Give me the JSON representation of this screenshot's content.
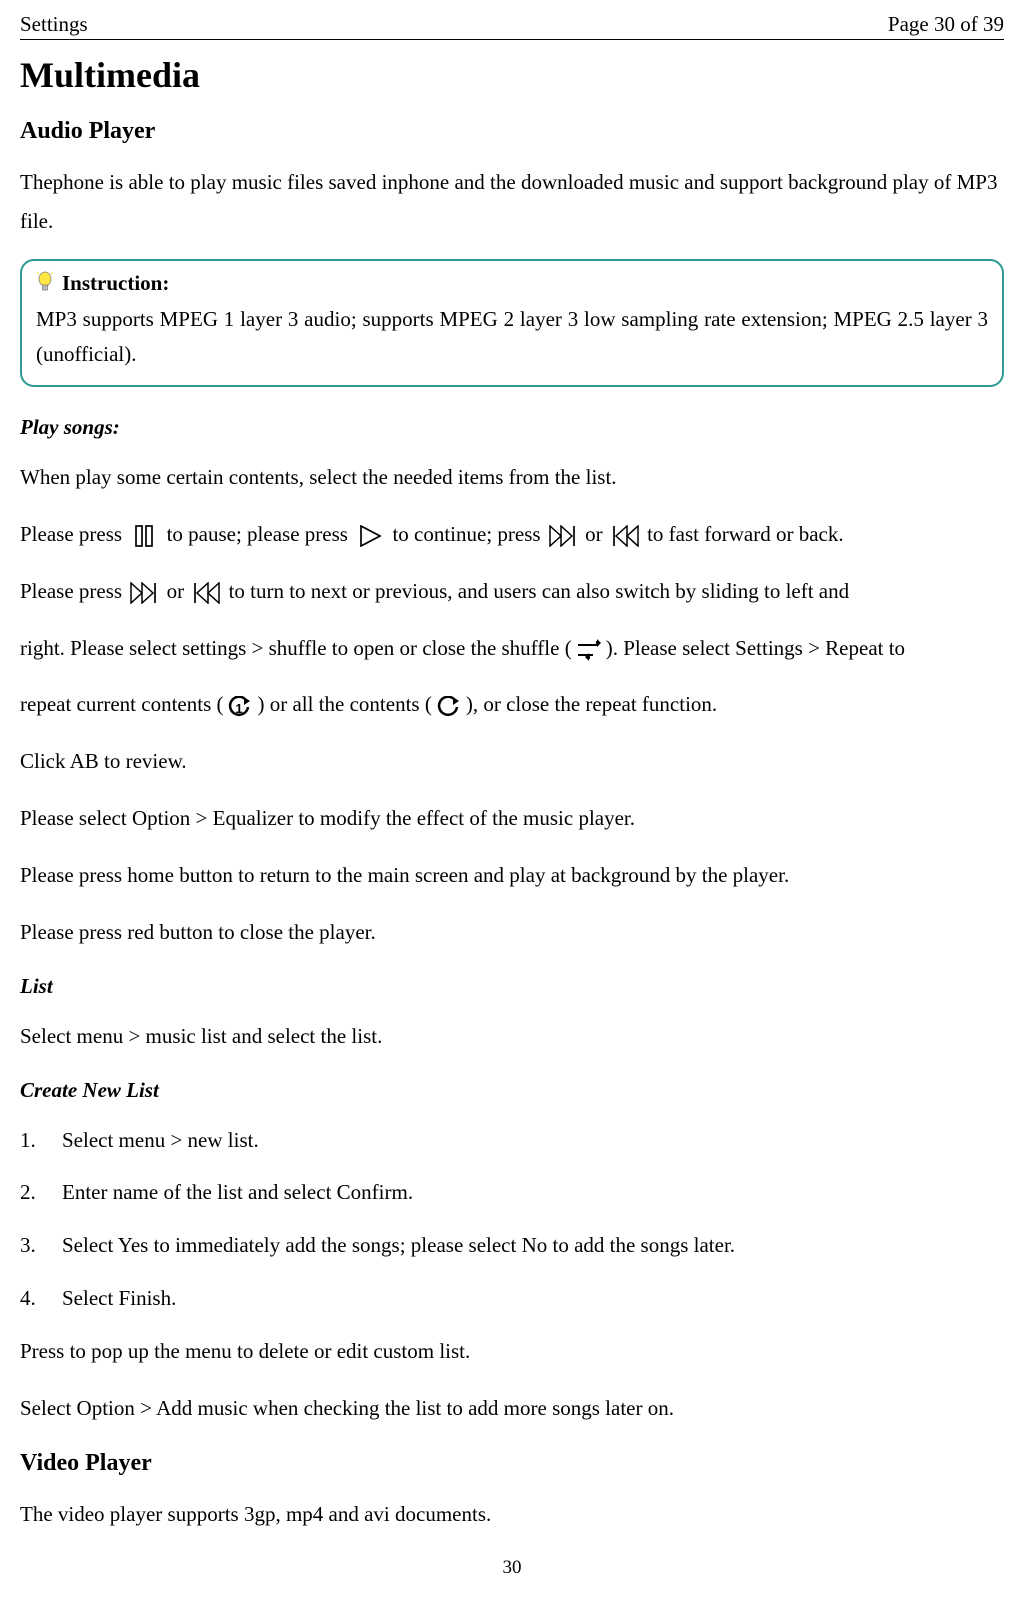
{
  "header": {
    "left": "Settings",
    "right": "Page 30 of 39"
  },
  "title": "Multimedia",
  "audio": {
    "heading": "Audio Player",
    "intro": "Thephone is able to play music files saved inphone and the downloaded music and support background play of MP3 file."
  },
  "callout": {
    "label": " Instruction:",
    "body": "MP3 supports MPEG 1 layer 3 audio; supports MPEG 2 layer 3 low sampling rate extension; MPEG 2.5 layer 3 (unofficial)."
  },
  "play": {
    "heading": "Play songs:",
    "line1": "When play some certain contents, select the needed items from the list.",
    "press1": "Please press",
    "pauseTail": " to pause; please press",
    "continueTail": " to continue; press",
    "orWord": " or",
    "ffbackTail": " to fast forward or back.",
    "press2": "Please press",
    "nextprevTail": " to turn to next or previous, and users can also switch by sliding to left and",
    "line3a": "right. Please select settings > shuffle to open or close the shuffle (",
    "line3b": "). Please select Settings > Repeat to",
    "line4a": "repeat current contents (",
    "line4b": ") or all the contents (",
    "line4c": "), or close the repeat function.",
    "abReview": "Click AB to review.",
    "equalizer": "Please select Option > Equalizer to modify the effect of the music player.",
    "homeBtn": "Please press home button to return to the main screen and play at background by the player.",
    "redBtn": "Please press red button to close the player."
  },
  "list": {
    "heading": "List",
    "text": "Select menu > music list and select the list."
  },
  "createList": {
    "heading": "Create New List",
    "steps": [
      "Select menu > new list.",
      "Enter name of the list and select Confirm.",
      "Select Yes to immediately add the songs; please select No to add the songs later.",
      "Select Finish."
    ],
    "popup": "Press to pop up the menu to delete or edit custom list.",
    "addMore": "Select Option > Add music when checking the list to add more songs later on."
  },
  "video": {
    "heading": "Video Player",
    "text": "The video player supports 3gp, mp4 and avi documents."
  },
  "footerPage": "30"
}
